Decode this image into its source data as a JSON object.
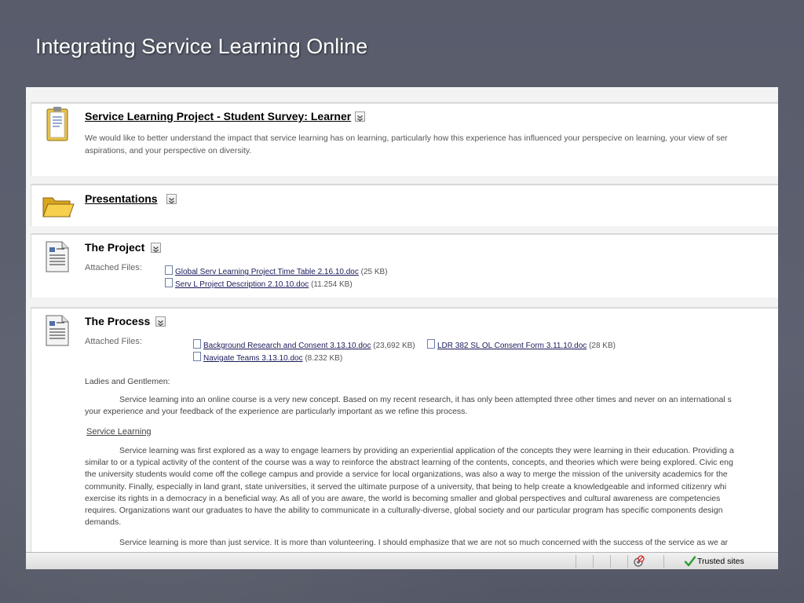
{
  "slide": {
    "title": "Integrating Service Learning Online"
  },
  "items": [
    {
      "title": "Service Learning Project - Student Survey: Learner",
      "description_lines": [
        "We would like to better understand the impact that service learning has on learning, particularly how this experience has influenced your perspecive on learning, your view of ser",
        "aspirations, and your perspective on diversity."
      ]
    },
    {
      "title": "Presentations"
    },
    {
      "title": "The Project",
      "attached_label": "Attached Files:",
      "files": [
        {
          "name": "Global Serv Learning Project Time Table 2.16.10.doc",
          "size": "(25 KB)"
        },
        {
          "name": "Serv L Project Description 2.10.10.doc",
          "size": "(11.254 KB)"
        }
      ]
    },
    {
      "title": "The Process",
      "attached_label": "Attached Files:",
      "files": [
        {
          "name": "Background Research and Consent 3.13.10.doc",
          "size": "(23,692 KB)"
        },
        {
          "name": "LDR 382 SL OL Consent Form 3.11.10.doc",
          "size": "(28 KB)"
        },
        {
          "name": "Navigate Teams 3.13.10.doc",
          "size": "(8.232 KB)"
        }
      ],
      "greeting": "Ladies and Gentlemen:",
      "para1_lines": [
        "Service learning into an online course is a very new concept. Based on my recent research, it has only been attempted three other times and never on an international s",
        "your experience and your feedback of the experience are particularly important as we refine this process."
      ],
      "section_heading": "Service Learning",
      "para2_lines": [
        "Service learning was first explored as a way to engage learners by providing an experiential application of the concepts they were learning in their education. Providing a",
        "similar to or a typical activity of the content of the course was a way to reinforce the abstract learning of the contents, concepts, and theories which were being explored. Civic eng",
        "the university students would come off the college campus and provide a service for local organizations, was also a way to merge the mission of the university academics for the",
        "community. Finally, especially in land grant, state universities, it served the ultimate purpose of a university, that being to help create a knowledgeable and informed citizenry whi",
        "exercise its rights in a democracy in a beneficial way. As all of you are aware, the world is becoming smaller and global perspectives and cultural awareness are competencies",
        "requires. Organizations want our graduates to have the ability to communicate in a culturally-diverse, global society and our particular program has specific components design",
        "demands."
      ],
      "para3": "Service learning is more than just service. It is more than volunteering. I should emphasize that we are not so much concerned with the success of the service as we ar"
    }
  ],
  "statusbar": {
    "zone_label": "Trusted sites"
  }
}
